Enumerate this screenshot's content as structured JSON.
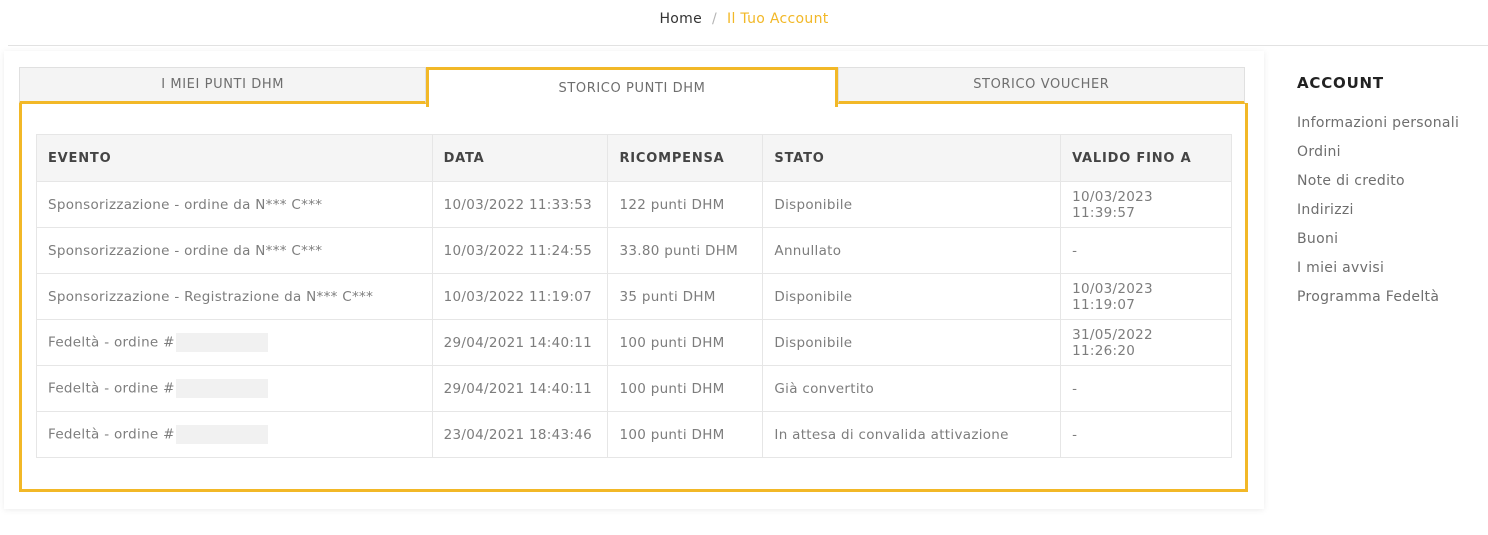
{
  "breadcrumb": {
    "home": "Home",
    "separator": "/",
    "current": "Il Tuo Account"
  },
  "colors": {
    "accent": "#f2b827"
  },
  "tabs": [
    {
      "label": "I MIEI PUNTI DHM",
      "active": false
    },
    {
      "label": "STORICO PUNTI DHM",
      "active": true
    },
    {
      "label": "STORICO VOUCHER",
      "active": false
    }
  ],
  "table": {
    "headers": [
      "EVENTO",
      "DATA",
      "RICOMPENSA",
      "STATO",
      "VALIDO FINO A"
    ],
    "rows": [
      {
        "evento": "Sponsorizzazione - ordine da N*** C***",
        "data": "10/03/2022 11:33:53",
        "ricompensa": "122 punti DHM",
        "stato": "Disponibile",
        "valido": "10/03/2023 11:39:57",
        "redacted": false
      },
      {
        "evento": "Sponsorizzazione - ordine da N*** C***",
        "data": "10/03/2022 11:24:55",
        "ricompensa": "33.80 punti DHM",
        "stato": "Annullato",
        "valido": "-",
        "redacted": false
      },
      {
        "evento": "Sponsorizzazione - Registrazione da N*** C***",
        "data": "10/03/2022 11:19:07",
        "ricompensa": "35 punti DHM",
        "stato": "Disponibile",
        "valido": "10/03/2023 11:19:07",
        "redacted": false
      },
      {
        "evento": "Fedeltà - ordine #",
        "data": "29/04/2021 14:40:11",
        "ricompensa": "100 punti DHM",
        "stato": "Disponibile",
        "valido": "31/05/2022 11:26:20",
        "redacted": true
      },
      {
        "evento": "Fedeltà - ordine #",
        "data": "29/04/2021 14:40:11",
        "ricompensa": "100 punti DHM",
        "stato": "Già convertito",
        "valido": "-",
        "redacted": true
      },
      {
        "evento": "Fedeltà - ordine #",
        "data": "23/04/2021 18:43:46",
        "ricompensa": "100 punti DHM",
        "stato": "In attesa di convalida attivazione",
        "valido": "-",
        "redacted": true
      }
    ]
  },
  "sidebar": {
    "title": "ACCOUNT",
    "items": [
      "Informazioni personali",
      "Ordini",
      "Note di credito",
      "Indirizzi",
      "Buoni",
      "I miei avvisi",
      "Programma Fedeltà"
    ]
  }
}
